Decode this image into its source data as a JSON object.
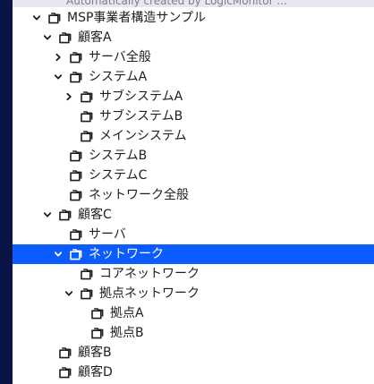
{
  "top_hint": "Automatically created by LogicMonitor ...",
  "tree": [
    {
      "label": "MSP事業者構造サンプル",
      "depth": 0,
      "caret": "down",
      "selected": false
    },
    {
      "label": "顧客A",
      "depth": 1,
      "caret": "down",
      "selected": false
    },
    {
      "label": "サーバ全般",
      "depth": 2,
      "caret": "right",
      "selected": false
    },
    {
      "label": "システムA",
      "depth": 2,
      "caret": "down",
      "selected": false
    },
    {
      "label": "サブシステムA",
      "depth": 3,
      "caret": "right",
      "selected": false
    },
    {
      "label": "サブシステムB",
      "depth": 3,
      "caret": "none",
      "selected": false
    },
    {
      "label": "メインシステム",
      "depth": 3,
      "caret": "none",
      "selected": false
    },
    {
      "label": "システムB",
      "depth": 2,
      "caret": "none",
      "selected": false
    },
    {
      "label": "システムC",
      "depth": 2,
      "caret": "none",
      "selected": false
    },
    {
      "label": "ネットワーク全般",
      "depth": 2,
      "caret": "none",
      "selected": false
    },
    {
      "label": "顧客C",
      "depth": 1,
      "caret": "down",
      "selected": false
    },
    {
      "label": "サーバ",
      "depth": 2,
      "caret": "none",
      "selected": false
    },
    {
      "label": "ネットワーク",
      "depth": 2,
      "caret": "down",
      "selected": true
    },
    {
      "label": "コアネットワーク",
      "depth": 3,
      "caret": "none",
      "selected": false
    },
    {
      "label": "拠点ネットワーク",
      "depth": 3,
      "caret": "down",
      "selected": false
    },
    {
      "label": "拠点A",
      "depth": 4,
      "caret": "none",
      "selected": false
    },
    {
      "label": "拠点B",
      "depth": 4,
      "caret": "none",
      "selected": false
    },
    {
      "label": "顧客B",
      "depth": 1,
      "caret": "none",
      "selected": false
    },
    {
      "label": "顧客D",
      "depth": 1,
      "caret": "none",
      "selected": false
    }
  ],
  "colors": {
    "selected_bg": "#0a5cff",
    "selected_text": "#ffffff",
    "text": "#1e1e1e",
    "sidebar_strip": "#0b1446"
  },
  "icons": {
    "expanded": "chevron-down-icon",
    "collapsed": "chevron-right-icon",
    "folder": "folder-icon"
  }
}
